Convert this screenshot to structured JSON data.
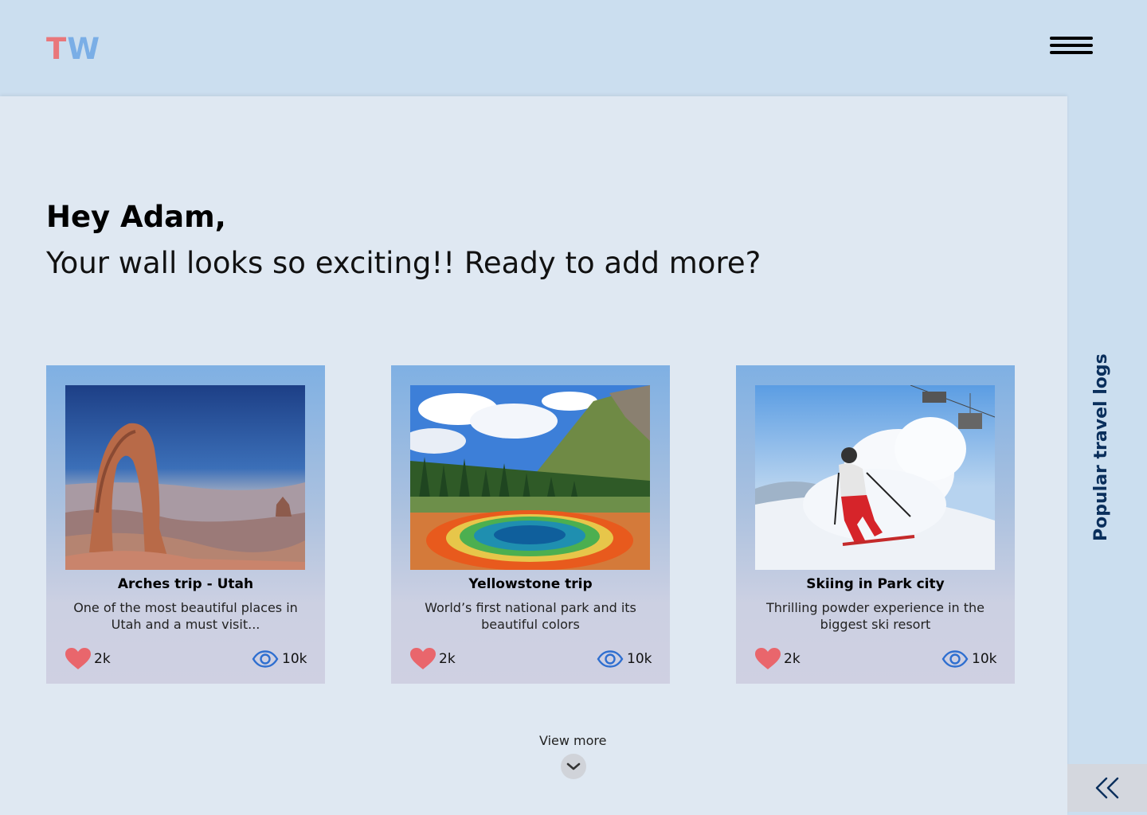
{
  "header": {
    "logo_t": "T",
    "logo_w": "W",
    "menu_icon": "hamburger-menu-icon"
  },
  "greeting": {
    "title": "Hey Adam,",
    "subtitle": "Your wall looks so exciting!! Ready to add more?"
  },
  "cards": [
    {
      "title": "Arches trip - Utah",
      "description": "One of the most beautiful places in Utah and a must visit...",
      "likes": "2k",
      "views": "10k",
      "photo": "delicate-arch-photo"
    },
    {
      "title": "Yellowstone trip",
      "description": "World’s first national park and its beautiful colors",
      "likes": "2k",
      "views": "10k",
      "photo": "yellowstone-hot-spring-photo"
    },
    {
      "title": "Skiing in Park city",
      "description": "Thrilling powder experience in the biggest ski resort",
      "likes": "2k",
      "views": "10k",
      "photo": "skier-photo"
    }
  ],
  "view_more": {
    "label": "View more",
    "icon": "chevron-down-icon"
  },
  "sidebar": {
    "label": "Popular travel logs",
    "collapse_icon": "double-chevron-left-icon"
  },
  "colors": {
    "logo_t": "#e9777b",
    "logo_w": "#7aaee6",
    "heart": "#e9666c",
    "eye": "#2f6fd0",
    "sidebar_text": "#0a2f5c",
    "header_bg": "#cbdeef",
    "main_bg": "#dfe8f2"
  }
}
